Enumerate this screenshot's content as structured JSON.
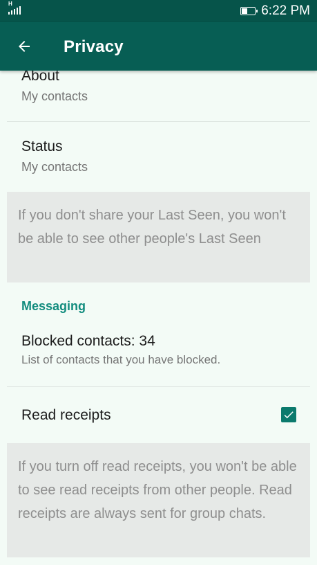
{
  "status_bar": {
    "network_type": "H",
    "time": "6:22 PM"
  },
  "app_bar": {
    "title": "Privacy",
    "back_icon": "arrow-back-icon"
  },
  "items": {
    "about": {
      "title": "About",
      "subtitle": "My contacts"
    },
    "status": {
      "title": "Status",
      "subtitle": "My contacts"
    },
    "last_seen_note": "If you don't share your Last Seen, you won't be able to see other people's Last Seen",
    "messaging_header": "Messaging",
    "blocked": {
      "title": "Blocked contacts: 34",
      "subtitle": "List of contacts that you have blocked."
    },
    "read_receipts": {
      "title": "Read receipts",
      "checked": true
    },
    "read_receipts_note": "If you turn off read receipts, you won't be able to see read receipts from other people. Read receipts are always sent for group chats."
  },
  "colors": {
    "status_bar": "#06544a",
    "app_bar": "#075e54",
    "accent": "#128c7e",
    "checkbox": "#0b7a6d",
    "info_bg": "#e6e9e7"
  }
}
